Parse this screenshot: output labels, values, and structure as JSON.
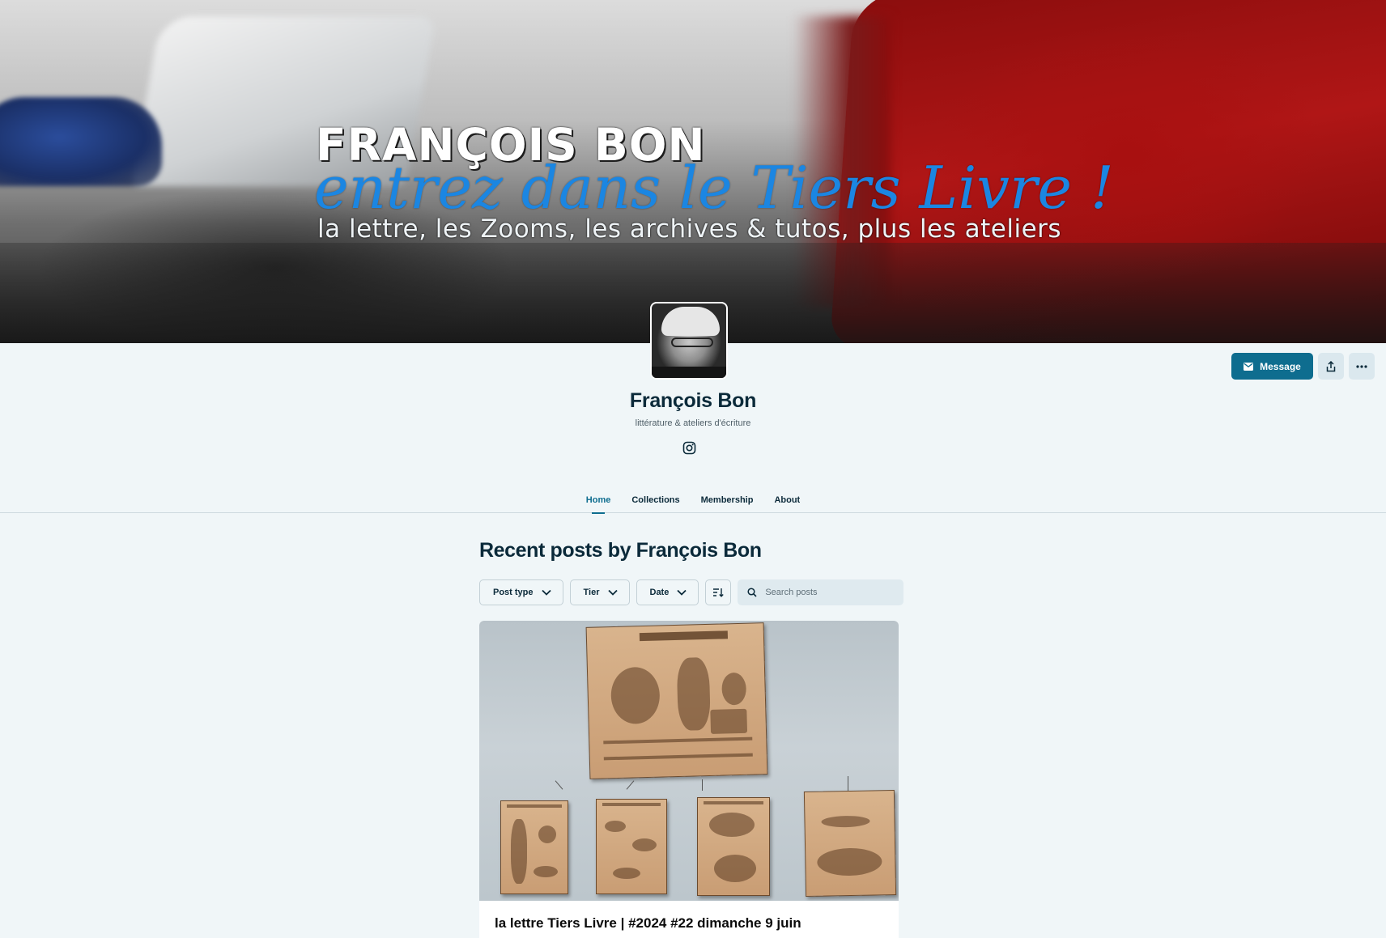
{
  "banner": {
    "title": "FRANÇOIS BON",
    "tagline": "entrez dans le Tiers Livre !",
    "subtitle": "la lettre, les Zooms, les archives & tutos, plus les ateliers"
  },
  "actions": {
    "message_label": "Message",
    "message_icon": "envelope-icon",
    "share_icon": "share-icon",
    "more_icon": "more-icon"
  },
  "profile": {
    "name": "François Bon",
    "description": "littérature & ateliers d'écriture",
    "social_icon": "instagram-icon"
  },
  "tabs": [
    {
      "label": "Home",
      "active": true
    },
    {
      "label": "Collections",
      "active": false
    },
    {
      "label": "Membership",
      "active": false
    },
    {
      "label": "About",
      "active": false
    }
  ],
  "main": {
    "title": "Recent posts by François Bon",
    "filters": {
      "post_type": "Post type",
      "tier": "Tier",
      "date": "Date",
      "sort_icon": "sort-icon"
    },
    "search": {
      "placeholder": "Search posts",
      "icon": "search-icon"
    }
  },
  "post": {
    "title": "la lettre Tiers Livre | #2024 #22 dimanche 9 juin"
  },
  "colors": {
    "accent": "#0e6d8f",
    "background": "#f0f6f8",
    "text": "#0b2a3a",
    "tagline_blue": "#1b86e2"
  }
}
